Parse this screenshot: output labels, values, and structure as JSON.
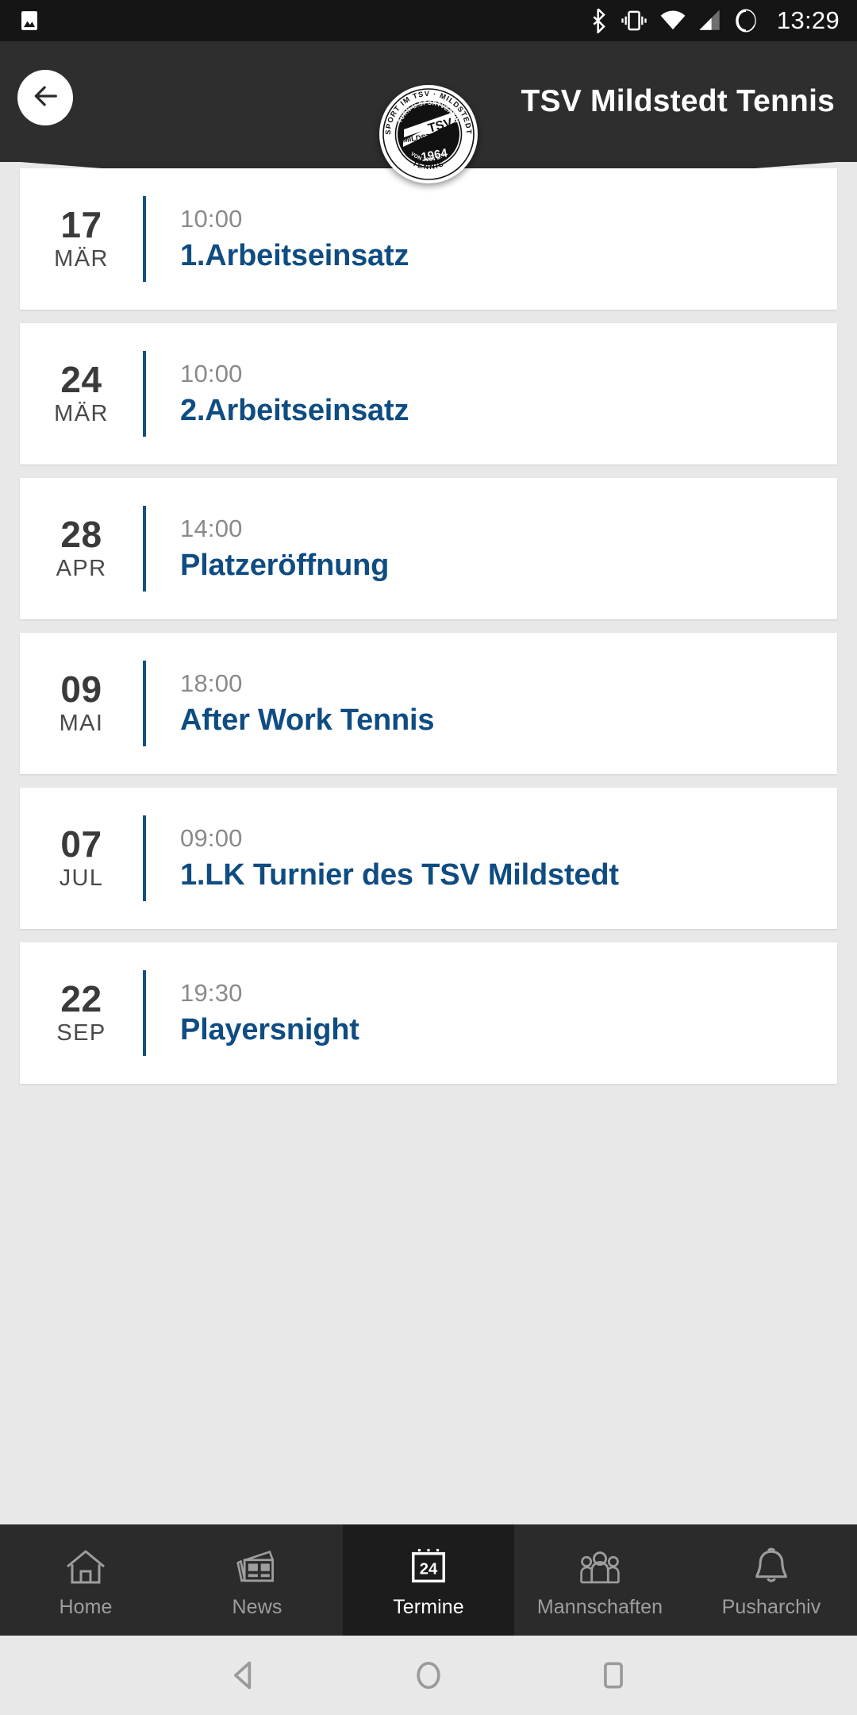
{
  "statusbar": {
    "time": "13:29",
    "icons": {
      "gallery": "image-icon",
      "bluetooth": "bluetooth-icon",
      "vibrate": "vibrate-icon",
      "wifi": "wifi-icon",
      "signal": "cellular-signal-icon",
      "battery": "battery-circle-icon"
    }
  },
  "header": {
    "title": "TSV Mildstedt Tennis",
    "back_icon": "back-arrow-icon",
    "logo": {
      "name": "tsv-mildstedt-club-logo",
      "outer_top_text": "SPORT IM TSV - MILDSTEDT",
      "outer_bottom_text": "TENNIS",
      "inner_top_text": "TURN-U.SPORTVEREIN",
      "main_text": "TSV",
      "sub_text": "MILDSTEDT",
      "year": "1964",
      "inner_bottom_text": "VON 1964 E.V."
    },
    "background_color": "#2e2e2e"
  },
  "events": [
    {
      "day": "17",
      "month": "MÄR",
      "time": "10:00",
      "title": "1.Arbeitseinsatz"
    },
    {
      "day": "24",
      "month": "MÄR",
      "time": "10:00",
      "title": "2.Arbeitseinsatz"
    },
    {
      "day": "28",
      "month": "APR",
      "time": "14:00",
      "title": "Platzeröffnung"
    },
    {
      "day": "09",
      "month": "MAI",
      "time": "18:00",
      "title": "After Work Tennis"
    },
    {
      "day": "07",
      "month": "JUL",
      "time": "09:00",
      "title": "1.LK Turnier des TSV Mildstedt"
    },
    {
      "day": "22",
      "month": "SEP",
      "time": "19:30",
      "title": "Playersnight"
    }
  ],
  "tabbar": {
    "tabs": [
      {
        "label": "Home",
        "icon": "home-icon",
        "active": false
      },
      {
        "label": "News",
        "icon": "news-icon",
        "active": false
      },
      {
        "label": "Termine",
        "icon": "calendar-icon",
        "active": true,
        "calendar_number": "24"
      },
      {
        "label": "Mannschaften",
        "icon": "people-icon",
        "active": false
      },
      {
        "label": "Pusharchiv",
        "icon": "bell-icon",
        "active": false
      }
    ]
  },
  "navbar": {
    "back": "android-back-icon",
    "home": "android-home-icon",
    "recents": "android-recents-icon"
  },
  "colors": {
    "accent_blue": "#0f4c82",
    "divider_blue": "#16507c",
    "header_bg": "#2e2e2e",
    "page_bg": "#e8e8e8",
    "card_bg": "#ffffff",
    "tabbar_bg": "#2b2b2b",
    "tab_active_bg": "#1c1c1c"
  }
}
